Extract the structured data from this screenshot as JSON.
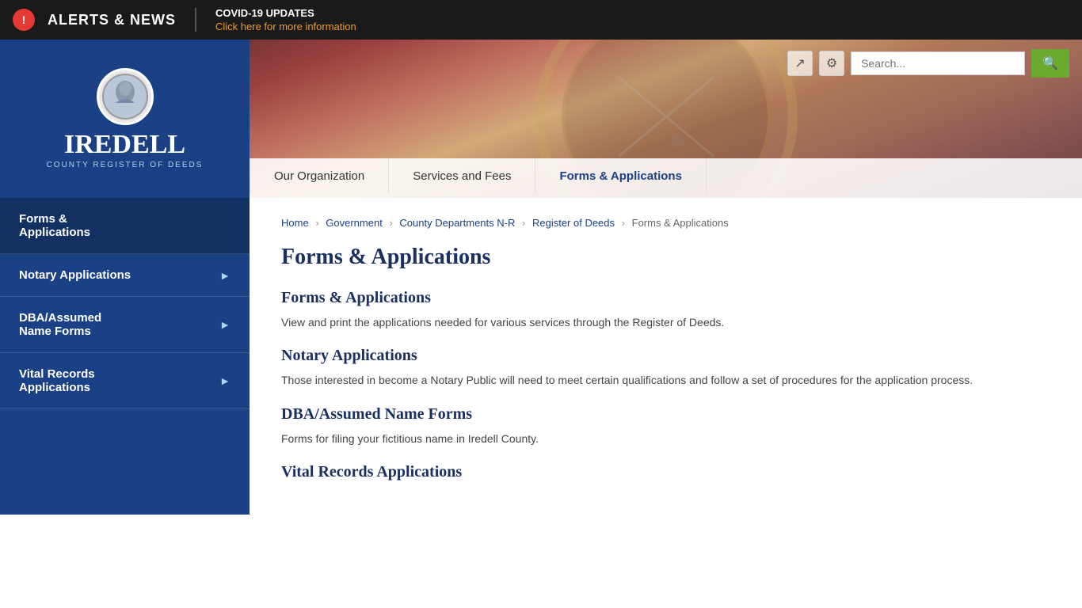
{
  "alert": {
    "icon": "!",
    "title": "ALERTS & NEWS",
    "covid_label": "COVID-19 UPDATES",
    "covid_link": "Click here for more information"
  },
  "header": {
    "logo_org": "IREDELL",
    "logo_sub": "COUNTY REGISTER OF DEEDS",
    "nav": {
      "items": [
        {
          "label": "Our Organization",
          "active": false
        },
        {
          "label": "Services and Fees",
          "active": false
        },
        {
          "label": "Forms & Applications",
          "active": true
        }
      ]
    },
    "search_placeholder": "Search..."
  },
  "breadcrumb": {
    "items": [
      "Home",
      "Government",
      "County Departments N-R",
      "Register of Deeds",
      "Forms & Applications"
    ],
    "separators": [
      "›",
      "›",
      "›",
      "›"
    ]
  },
  "page": {
    "title": "Forms & Applications",
    "sections": [
      {
        "heading": "Forms & Applications",
        "text": "View and print the applications needed for various services through the Register of Deeds."
      },
      {
        "heading": "Notary Applications",
        "text": "Those interested in become a Notary Public will need to meet certain qualifications and follow a set of procedures for the application process."
      },
      {
        "heading": "DBA/Assumed Name Forms",
        "text": "Forms for filing your fictitious name in Iredell County."
      },
      {
        "heading": "Vital Records Applications",
        "text": ""
      }
    ]
  },
  "sidebar": {
    "items": [
      {
        "label": "Forms &\nApplications",
        "has_arrow": false
      },
      {
        "label": "Notary Applications",
        "has_arrow": true
      },
      {
        "label": "DBA/Assumed\nName Forms",
        "has_arrow": true
      },
      {
        "label": "Vital Records\nApplications",
        "has_arrow": true
      }
    ]
  },
  "toolbar": {
    "share_icon": "↗",
    "gear_icon": "⚙",
    "search_icon": "🔍"
  }
}
